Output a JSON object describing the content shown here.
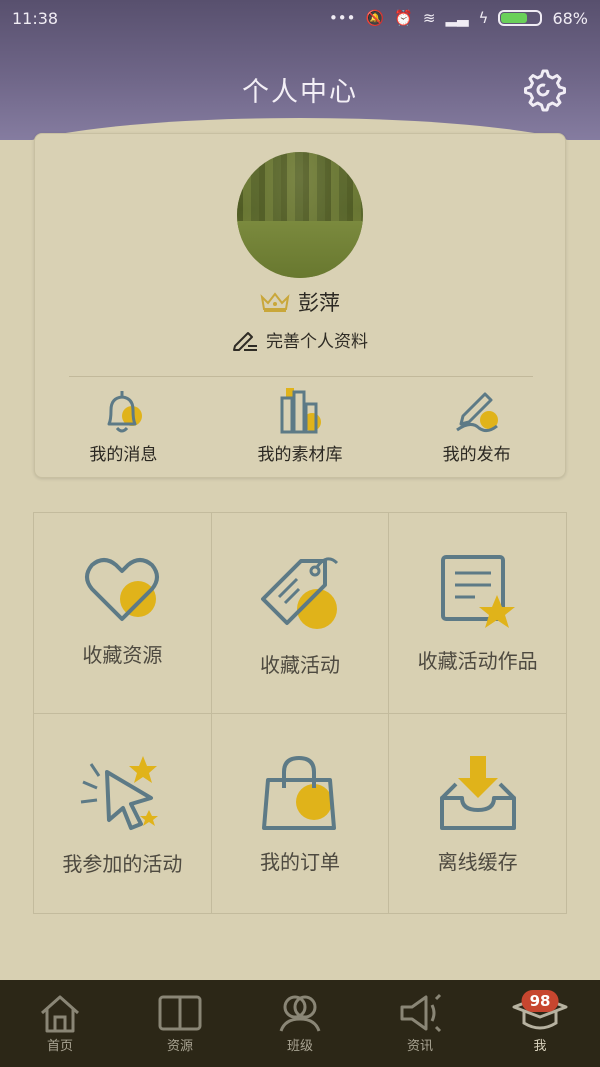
{
  "status_bar": {
    "time": "11:38",
    "battery": "68%"
  },
  "header": {
    "title": "个人中心",
    "settings_icon": "gear-icon"
  },
  "profile": {
    "name": "彭萍",
    "edit_label": "完善个人资料",
    "crown_color": "#c9a73a",
    "quick_links": [
      {
        "label": "我的消息",
        "icon": "bell-icon"
      },
      {
        "label": "我的素材库",
        "icon": "library-icon"
      },
      {
        "label": "我的发布",
        "icon": "pen-icon"
      }
    ]
  },
  "grid": [
    {
      "label": "收藏资源",
      "icon": "heart-icon"
    },
    {
      "label": "收藏活动",
      "icon": "tag-icon"
    },
    {
      "label": "收藏活动作品",
      "icon": "document-star-icon"
    },
    {
      "label": "我参加的活动",
      "icon": "cursor-star-icon"
    },
    {
      "label": "我的订单",
      "icon": "shopping-bag-icon"
    },
    {
      "label": "离线缓存",
      "icon": "download-tray-icon"
    }
  ],
  "bottom_nav": [
    {
      "label": "首页",
      "icon": "home-icon"
    },
    {
      "label": "资源",
      "icon": "book-icon"
    },
    {
      "label": "班级",
      "icon": "users-icon"
    },
    {
      "label": "资讯",
      "icon": "megaphone-icon"
    },
    {
      "label": "我",
      "icon": "graduation-cap-icon",
      "badge": "98",
      "active": true
    }
  ],
  "colors": {
    "accent_yellow": "#e0b31a",
    "icon_stroke": "#5d7a86",
    "badge_red": "#c7462f",
    "header_purple": "#6f6688"
  }
}
